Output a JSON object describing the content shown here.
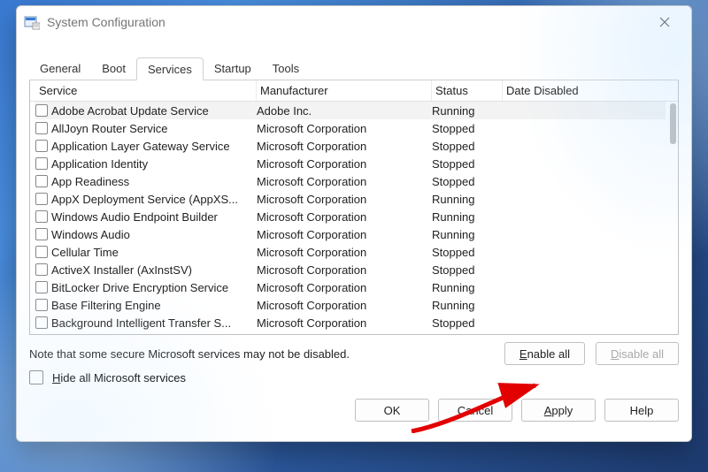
{
  "window": {
    "title": "System Configuration"
  },
  "tabs": [
    "General",
    "Boot",
    "Services",
    "Startup",
    "Tools"
  ],
  "active_tab": "Services",
  "columns": {
    "service": "Service",
    "manufacturer": "Manufacturer",
    "status": "Status",
    "date_disabled": "Date Disabled"
  },
  "services": [
    {
      "name": "Adobe Acrobat Update Service",
      "mfr": "Adobe Inc.",
      "status": "Running",
      "date": "",
      "selected": true
    },
    {
      "name": "AllJoyn Router Service",
      "mfr": "Microsoft Corporation",
      "status": "Stopped",
      "date": ""
    },
    {
      "name": "Application Layer Gateway Service",
      "mfr": "Microsoft Corporation",
      "status": "Stopped",
      "date": ""
    },
    {
      "name": "Application Identity",
      "mfr": "Microsoft Corporation",
      "status": "Stopped",
      "date": ""
    },
    {
      "name": "App Readiness",
      "mfr": "Microsoft Corporation",
      "status": "Stopped",
      "date": ""
    },
    {
      "name": "AppX Deployment Service (AppXS...",
      "mfr": "Microsoft Corporation",
      "status": "Running",
      "date": ""
    },
    {
      "name": "Windows Audio Endpoint Builder",
      "mfr": "Microsoft Corporation",
      "status": "Running",
      "date": ""
    },
    {
      "name": "Windows Audio",
      "mfr": "Microsoft Corporation",
      "status": "Running",
      "date": ""
    },
    {
      "name": "Cellular Time",
      "mfr": "Microsoft Corporation",
      "status": "Stopped",
      "date": ""
    },
    {
      "name": "ActiveX Installer (AxInstSV)",
      "mfr": "Microsoft Corporation",
      "status": "Stopped",
      "date": ""
    },
    {
      "name": "BitLocker Drive Encryption Service",
      "mfr": "Microsoft Corporation",
      "status": "Running",
      "date": ""
    },
    {
      "name": "Base Filtering Engine",
      "mfr": "Microsoft Corporation",
      "status": "Running",
      "date": ""
    },
    {
      "name": "Background Intelligent Transfer S...",
      "mfr": "Microsoft Corporation",
      "status": "Stopped",
      "date": ""
    }
  ],
  "note": "Note that some secure Microsoft services may not be disabled.",
  "buttons": {
    "enable_all": "Enable all",
    "disable_all": "Disable all",
    "hide_ms": "Hide all Microsoft services",
    "ok": "OK",
    "cancel": "Cancel",
    "apply": "Apply",
    "help": "Help"
  }
}
